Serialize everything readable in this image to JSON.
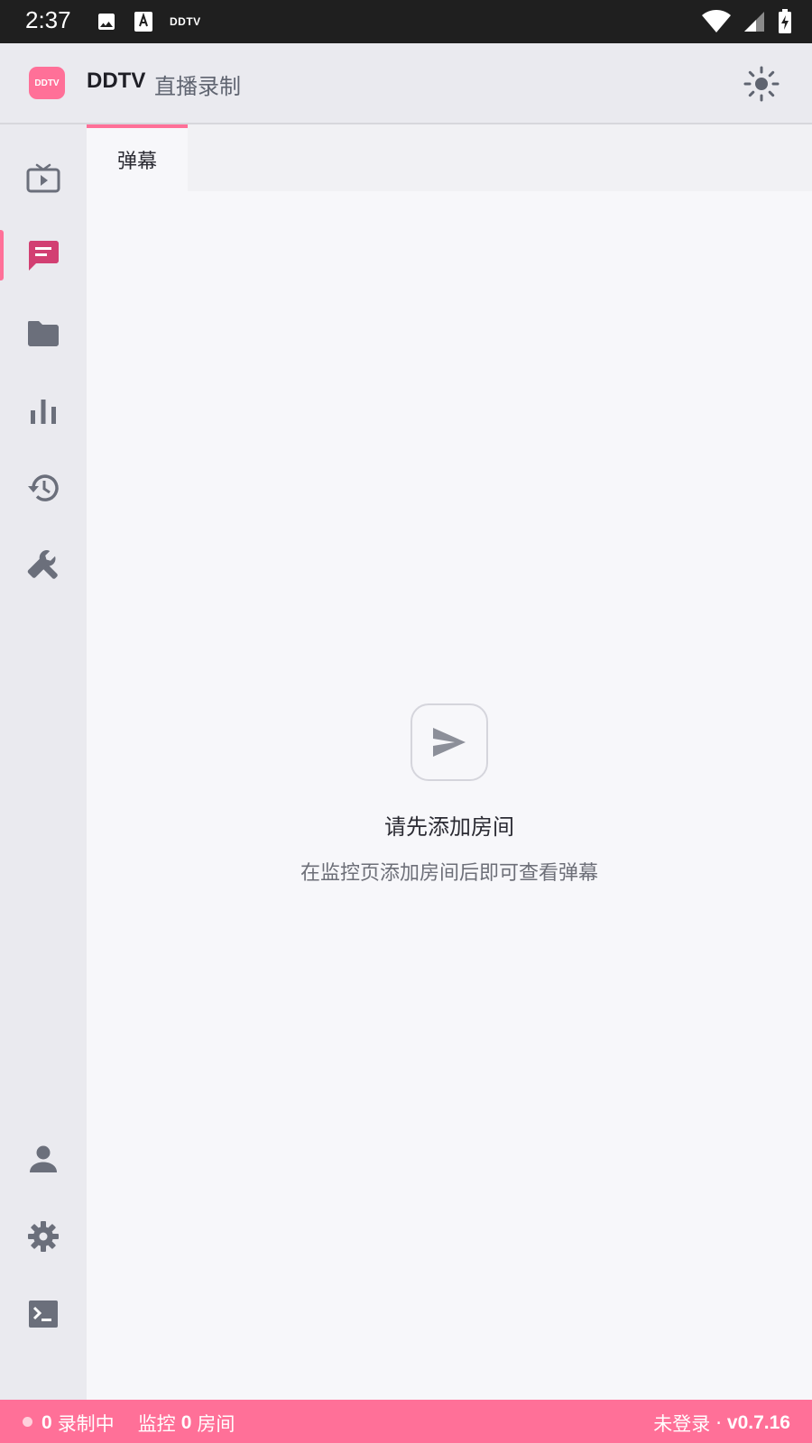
{
  "status_bar": {
    "time": "2:37",
    "notification_text": "DDTV",
    "icons": [
      "image-icon",
      "font-icon",
      "wifi-icon",
      "signal-icon",
      "battery-charging-icon"
    ]
  },
  "header": {
    "logo_text": "DDTV",
    "app_name": "DDTV",
    "subtitle": "直播录制",
    "theme_icon": "sun-icon"
  },
  "sidebar": {
    "active_index": 1,
    "top_items": [
      "tv-icon",
      "chat-icon",
      "folder-icon",
      "bar-chart-icon",
      "history-icon",
      "wrench-icon"
    ],
    "bottom_items": [
      "person-icon",
      "gear-icon",
      "terminal-icon"
    ]
  },
  "tabs": [
    {
      "label": "弹幕",
      "active": true
    }
  ],
  "empty_state": {
    "icon": "send-icon",
    "title": "请先添加房间",
    "description": "在监控页添加房间后即可查看弹幕"
  },
  "footer": {
    "recording_count": "0",
    "recording_label": "录制中",
    "monitor_prefix": "监控",
    "monitor_count": "0",
    "monitor_suffix": "房间",
    "login_status": "未登录",
    "separator": "·",
    "version": "v0.7.16"
  },
  "colors": {
    "accent": "#ff7098",
    "sidebar_bg": "#eaeaef",
    "icon_gray": "#6b6f7b",
    "active_icon": "#d23f72"
  }
}
